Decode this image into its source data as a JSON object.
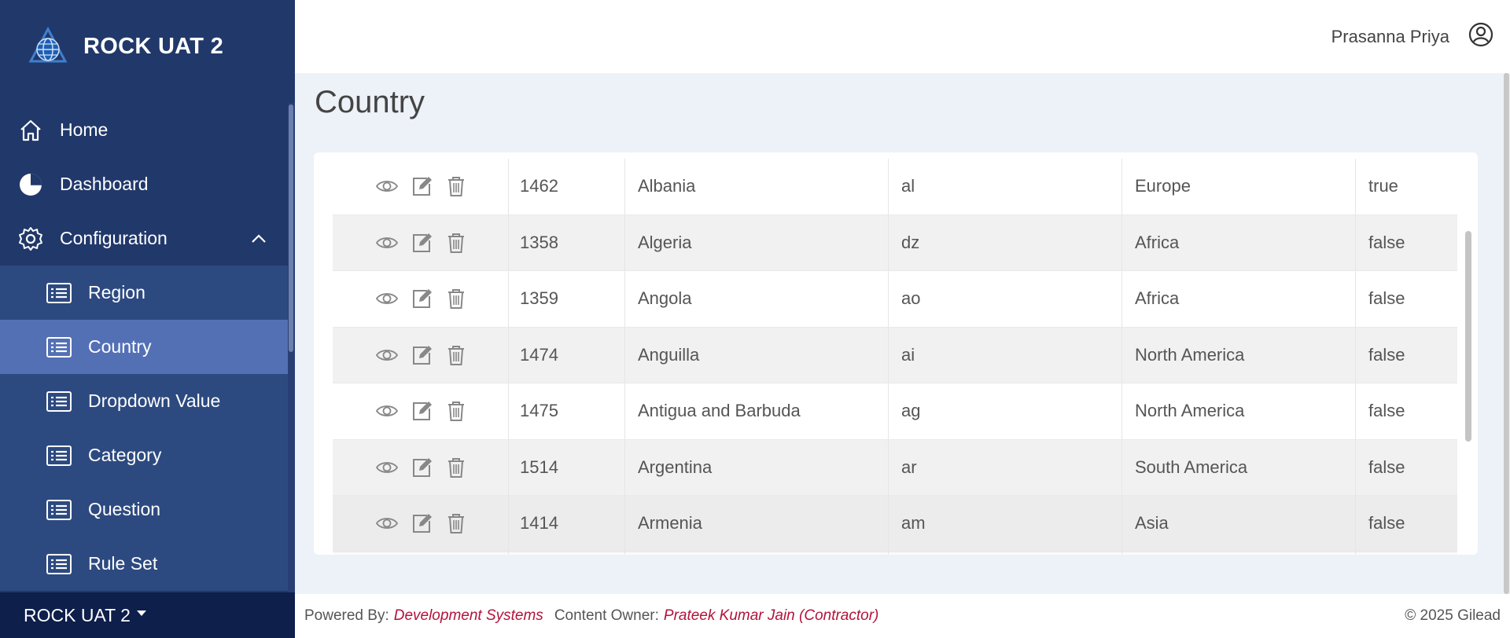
{
  "app": {
    "title": "ROCK UAT 2"
  },
  "sidebar": {
    "items": [
      {
        "label": "Home",
        "icon": "home-icon"
      },
      {
        "label": "Dashboard",
        "icon": "pie-chart-icon"
      },
      {
        "label": "Configuration",
        "icon": "gear-icon",
        "expanded": true
      }
    ],
    "subitems": [
      {
        "label": "Region",
        "icon": "list-icon"
      },
      {
        "label": "Country",
        "icon": "list-icon",
        "active": true
      },
      {
        "label": "Dropdown Value",
        "icon": "list-icon"
      },
      {
        "label": "Category",
        "icon": "list-icon"
      },
      {
        "label": "Question",
        "icon": "list-icon"
      },
      {
        "label": "Rule Set",
        "icon": "list-icon"
      }
    ],
    "footer_label": "ROCK UAT 2"
  },
  "header": {
    "user_name": "Prasanna Priya"
  },
  "page": {
    "title": "Country"
  },
  "table": {
    "rows": [
      {
        "id": "1462",
        "name": "Albania",
        "code": "al",
        "region": "Europe",
        "flag": "true"
      },
      {
        "id": "1358",
        "name": "Algeria",
        "code": "dz",
        "region": "Africa",
        "flag": "false"
      },
      {
        "id": "1359",
        "name": "Angola",
        "code": "ao",
        "region": "Africa",
        "flag": "false"
      },
      {
        "id": "1474",
        "name": "Anguilla",
        "code": "ai",
        "region": "North America",
        "flag": "false"
      },
      {
        "id": "1475",
        "name": "Antigua and Barbuda",
        "code": "ag",
        "region": "North America",
        "flag": "false"
      },
      {
        "id": "1514",
        "name": "Argentina",
        "code": "ar",
        "region": "South America",
        "flag": "false"
      },
      {
        "id": "1414",
        "name": "Armenia",
        "code": "am",
        "region": "Asia",
        "flag": "false"
      }
    ]
  },
  "footer": {
    "powered_label": "Powered By:",
    "powered_value": "Development Systems",
    "owner_label": "Content Owner:",
    "owner_value": "Prateek Kumar Jain (Contractor)",
    "copyright": "© 2025 Gilead"
  },
  "colors": {
    "sidebar": "#21386a",
    "active": "#5470b5",
    "link": "#b3123a"
  }
}
